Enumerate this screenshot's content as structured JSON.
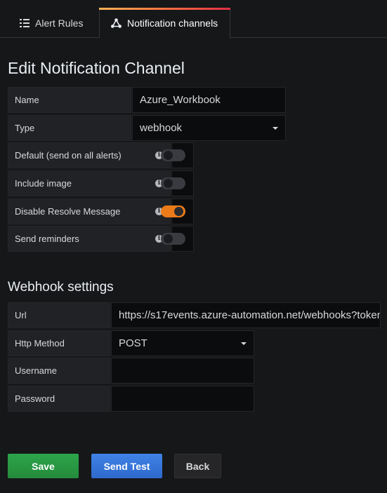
{
  "tabs": [
    {
      "label": "Alert Rules",
      "icon": "list-icon",
      "active": false
    },
    {
      "label": "Notification channels",
      "icon": "share-nodes-icon",
      "active": true
    }
  ],
  "title": "Edit Notification Channel",
  "form": {
    "name_label": "Name",
    "name_value": "Azure_Workbook",
    "type_label": "Type",
    "type_value": "webhook",
    "toggles": [
      {
        "label": "Default (send on all alerts)",
        "on": false
      },
      {
        "label": "Include image",
        "on": false
      },
      {
        "label": "Disable Resolve Message",
        "on": true
      },
      {
        "label": "Send reminders",
        "on": false
      }
    ]
  },
  "webhook": {
    "heading": "Webhook settings",
    "url_label": "Url",
    "url_value": "https://s17events.azure-automation.net/webhooks?token",
    "method_label": "Http Method",
    "method_value": "POST",
    "username_label": "Username",
    "username_value": "",
    "password_label": "Password",
    "password_value": ""
  },
  "buttons": {
    "save": "Save",
    "test": "Send Test",
    "back": "Back"
  },
  "colors": {
    "toggle_on": "#eb7b18",
    "save": "#2da54b",
    "test": "#3f82e6"
  }
}
